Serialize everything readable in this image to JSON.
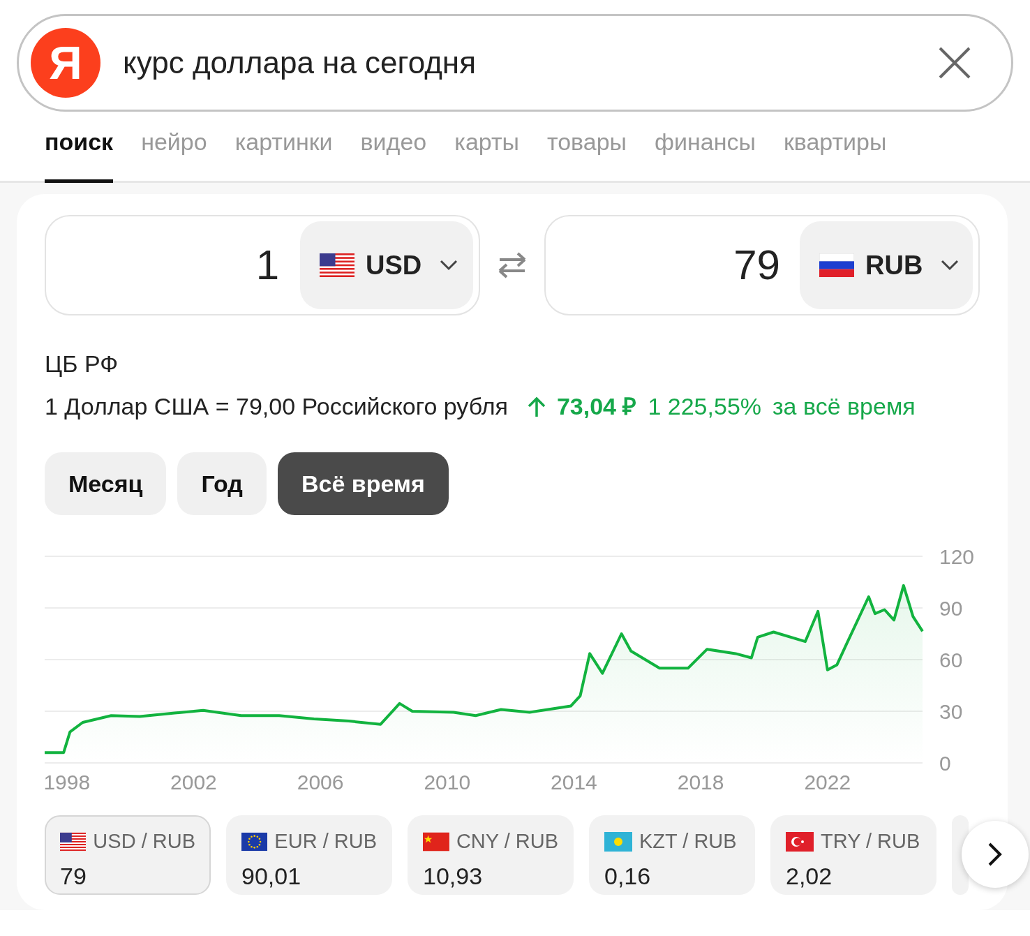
{
  "search": {
    "logo": "Я",
    "query": "курс доллара на сегодня"
  },
  "tabs": [
    {
      "label": "поиск",
      "selected": true
    },
    {
      "label": "нейро",
      "selected": false
    },
    {
      "label": "картинки",
      "selected": false
    },
    {
      "label": "видео",
      "selected": false
    },
    {
      "label": "карты",
      "selected": false
    },
    {
      "label": "товары",
      "selected": false
    },
    {
      "label": "финансы",
      "selected": false
    },
    {
      "label": "квартиры",
      "selected": false
    }
  ],
  "converter": {
    "from": {
      "amount": "1",
      "currency": "USD",
      "kind": "us"
    },
    "to": {
      "amount": "79",
      "currency": "RUB",
      "kind": "ru"
    }
  },
  "source": "ЦБ РФ",
  "rate_text": "1 Доллар США = 79,00 Российского рубля",
  "change": {
    "amount": "73,04 ₽",
    "percent": "1 225,55%",
    "period": "за всё время"
  },
  "periods": [
    {
      "label": "Месяц",
      "selected": false
    },
    {
      "label": "Год",
      "selected": false
    },
    {
      "label": "Всё время",
      "selected": true
    }
  ],
  "chart_data": {
    "type": "area",
    "grid": true,
    "xlim": [
      1997.3,
      2025.0
    ],
    "ylim": [
      0,
      120
    ],
    "xticks": [
      {
        "value": 1998,
        "label": "1998"
      },
      {
        "value": 2002,
        "label": "2002"
      },
      {
        "value": 2006,
        "label": "2006"
      },
      {
        "value": 2010,
        "label": "2010"
      },
      {
        "value": 2014,
        "label": "2014"
      },
      {
        "value": 2018,
        "label": "2018"
      },
      {
        "value": 2022,
        "label": "2022"
      }
    ],
    "yticks": [
      0,
      30,
      60,
      90,
      120
    ],
    "x": [
      1997.3,
      1997.9,
      1998.1,
      1998.5,
      1999.4,
      2000.3,
      2001.4,
      2002.3,
      2003.5,
      2004.7,
      2005.8,
      2006.9,
      2007.9,
      2008.5,
      2008.9,
      2010.2,
      2010.9,
      2011.7,
      2012.6,
      2013.9,
      2014.2,
      2014.5,
      2014.9,
      2015.5,
      2015.8,
      2016.7,
      2017.6,
      2018.2,
      2019.1,
      2019.6,
      2019.8,
      2020.3,
      2021.3,
      2021.7,
      2022.0,
      2022.3,
      2022.6,
      2023.3,
      2023.5,
      2023.8,
      2024.1,
      2024.4,
      2024.7,
      2025.0
    ],
    "series": [
      {
        "color": "#12b33f",
        "values": [
          6,
          6,
          18,
          23.5,
          27.5,
          27,
          29,
          30.5,
          27.5,
          27.5,
          25.5,
          24.3,
          22.4,
          34.5,
          30,
          29.4,
          27.5,
          31,
          29.4,
          33,
          39,
          63.5,
          52,
          75,
          65,
          55,
          55,
          66,
          63.5,
          61,
          73,
          76,
          70.5,
          88,
          54,
          57,
          69,
          96.5,
          86.7,
          89,
          83,
          103,
          85,
          76.5
        ]
      }
    ]
  },
  "pairs": [
    {
      "label": "USD / RUB",
      "value": "79",
      "kind": "us",
      "selected": true
    },
    {
      "label": "EUR / RUB",
      "value": "90,01",
      "kind": "eu",
      "selected": false
    },
    {
      "label": "CNY / RUB",
      "value": "10,93",
      "kind": "cn",
      "selected": false
    },
    {
      "label": "KZT / RUB",
      "value": "0,16",
      "kind": "kz",
      "selected": false
    },
    {
      "label": "TRY / RUB",
      "value": "2,02",
      "kind": "tr",
      "selected": false
    },
    {
      "kind": "partial",
      "selected": false
    }
  ]
}
